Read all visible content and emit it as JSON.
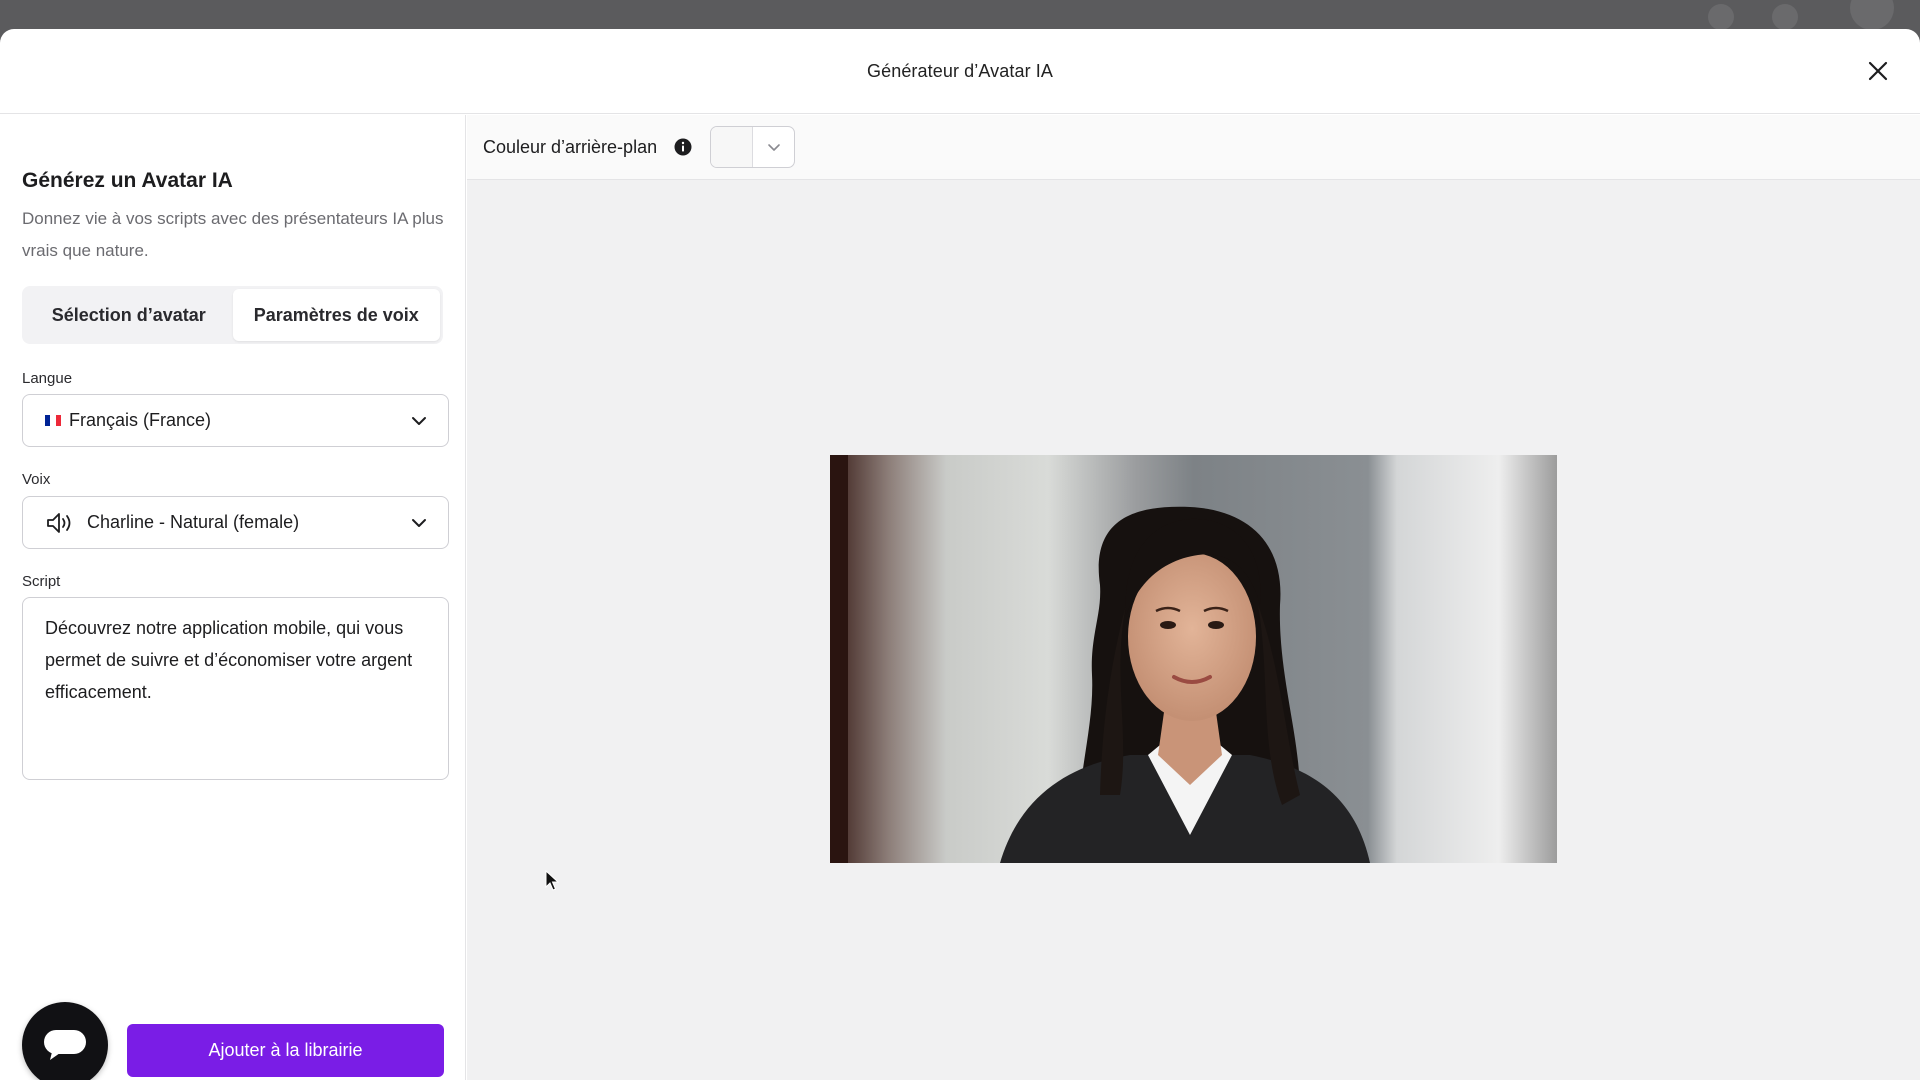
{
  "modal": {
    "title": "Générateur d’Avatar IA"
  },
  "panel": {
    "title": "Générez un Avatar IA",
    "subtitle": "Donnez vie à vos scripts avec des présentateurs IA plus vrais que nature.",
    "tabs": [
      {
        "label": "Sélection d’avatar",
        "active": false
      },
      {
        "label": "Paramètres de voix",
        "active": true
      }
    ],
    "language": {
      "label": "Langue",
      "value": "Français (France)",
      "flag_colors": [
        "#002395",
        "#ffffff",
        "#ed2939"
      ]
    },
    "voice": {
      "label": "Voix",
      "value": "Charline - Natural (female)"
    },
    "script": {
      "label": "Script",
      "value": "Découvrez notre application mobile, qui vous permet de suivre et d’économiser votre argent efficacement."
    },
    "add_button_label": "Ajouter à la librairie"
  },
  "toolbar": {
    "background_color_label": "Couleur d’arrière-plan",
    "selected_color": "#f7f7f7"
  },
  "icons": {
    "close": "close-icon",
    "info": "info-icon",
    "speaker": "speaker-icon",
    "chevron": "chevron-down-icon",
    "chat": "chat-icon"
  },
  "colors": {
    "accent": "#7a1de6",
    "fab": "#111114"
  }
}
